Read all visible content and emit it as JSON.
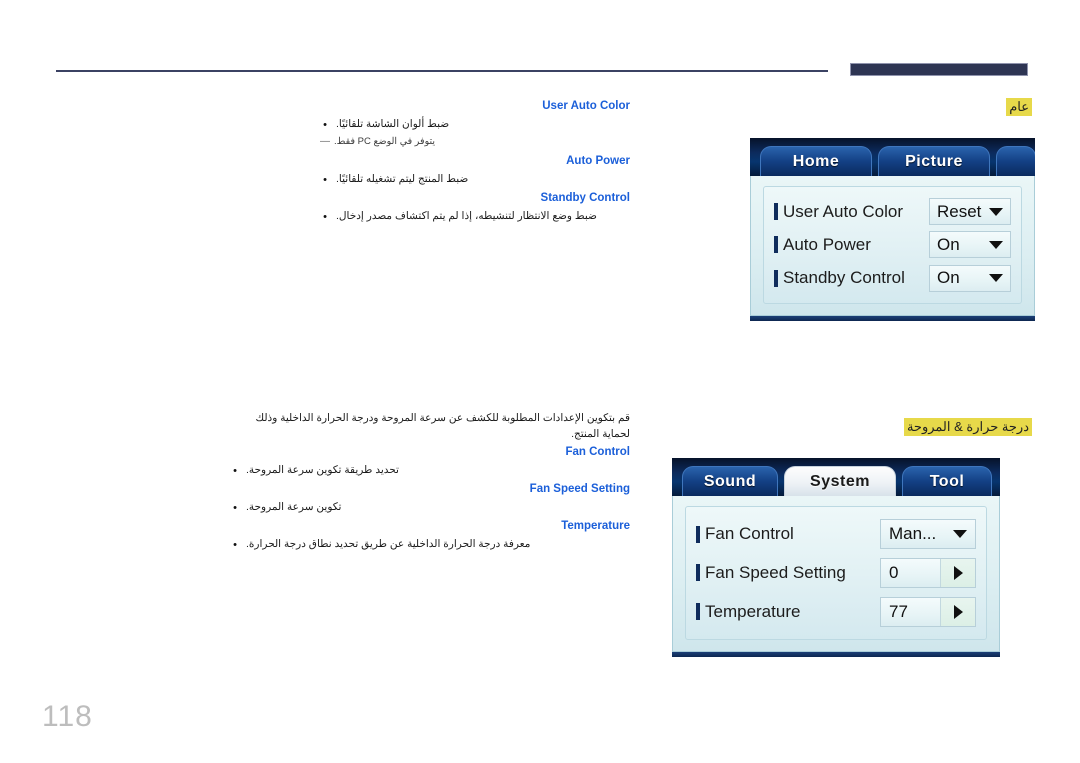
{
  "page": {
    "number": "118"
  },
  "sections": [
    {
      "label": "عام",
      "intro": "",
      "items": [
        {
          "heading": "User Auto Color",
          "bullets": [
            "ضبط ألوان الشاشة تلقائيًا."
          ],
          "note": "يتوفر في الوضع PC فقط.",
          "note_en": "PC"
        },
        {
          "heading": "Auto Power",
          "bullets": [
            "ضبط المنتج ليتم تشغيله تلقائيًا."
          ],
          "note": ""
        },
        {
          "heading": "Standby Control",
          "bullets": [
            "ضبط وضع الانتظار لتنشيطه، إذا لم يتم اكتشاف مصدر إدخال."
          ],
          "note": ""
        }
      ],
      "osd": {
        "tabs": [
          {
            "label": "Home",
            "active": false
          },
          {
            "label": "Picture",
            "active": false
          }
        ],
        "rows": [
          {
            "label": "User Auto Color",
            "value": "Reset",
            "control": "caret-down"
          },
          {
            "label": "Auto Power",
            "value": "On",
            "control": "caret-down"
          },
          {
            "label": "Standby Control",
            "value": "On",
            "control": "caret-down"
          }
        ]
      }
    },
    {
      "label": "درجة حرارة & المروحة",
      "intro": "قم بتكوين الإعدادات المطلوبة للكشف عن سرعة المروحة ودرجة الحرارة الداخلية وذلك لحماية المنتج.",
      "items": [
        {
          "heading": "Fan Control",
          "bullets": [
            "تحديد طريقة تكوين سرعة المروحة."
          ],
          "note": ""
        },
        {
          "heading": "Fan Speed Setting",
          "bullets": [
            "تكوين سرعة المروحة."
          ],
          "note": ""
        },
        {
          "heading": "Temperature",
          "bullets": [
            "معرفة درجة الحرارة الداخلية عن طريق تحديد نطاق درجة الحرارة."
          ],
          "note": ""
        }
      ],
      "osd": {
        "tabs": [
          {
            "label": "Sound",
            "active": false
          },
          {
            "label": "System",
            "active": true
          },
          {
            "label": "Tool",
            "active": false
          }
        ],
        "rows": [
          {
            "label": "Fan Control",
            "value": "Man...",
            "control": "caret-down"
          },
          {
            "label": "Fan Speed Setting",
            "value": "0",
            "control": "caret-right"
          },
          {
            "label": "Temperature",
            "value": "77",
            "control": "caret-right"
          }
        ]
      }
    }
  ],
  "colors": {
    "heading_blue": "#1b5fd9",
    "highlight_yellow": "#e7d94a",
    "rule_navy": "#3b4263",
    "page_num_gray": "#bdbdbd"
  }
}
